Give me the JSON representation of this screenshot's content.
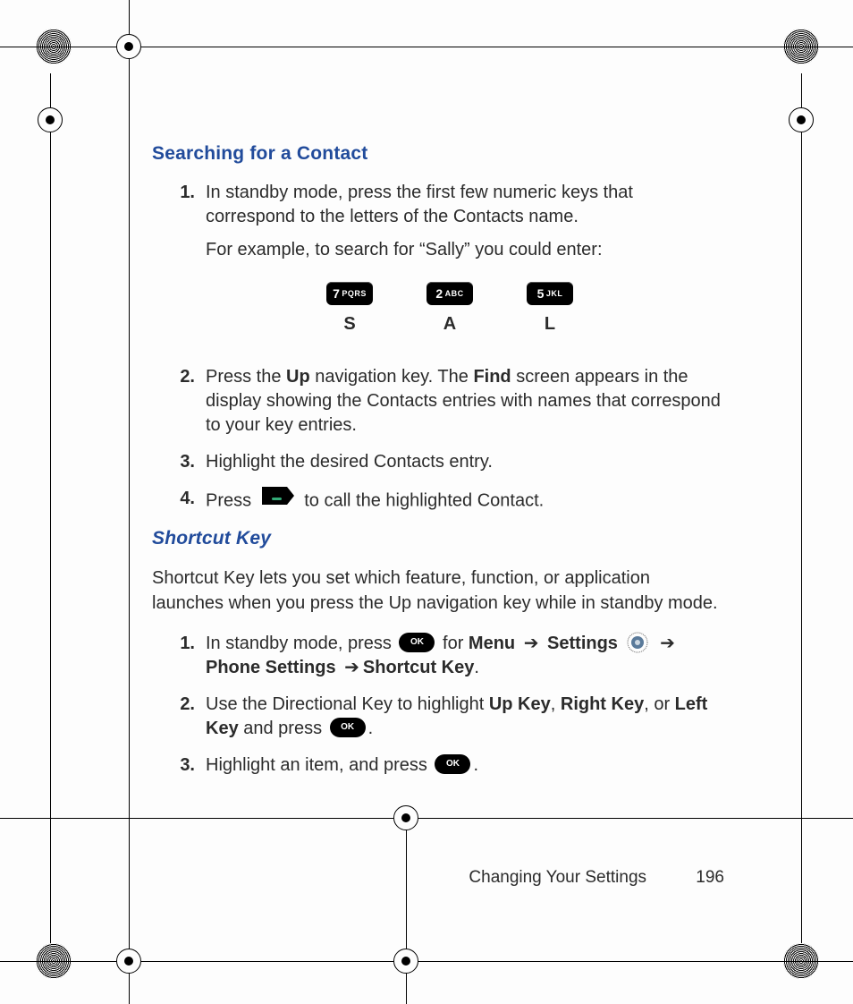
{
  "section1": {
    "heading": "Searching for a Contact",
    "steps": [
      {
        "num": "1.",
        "text_a": "In standby mode, press the first few numeric keys that correspond to the letters of the Contacts name.",
        "text_b": "For example, to search for “Sally” you could enter:"
      },
      {
        "num": "2.",
        "parts": [
          "Press the ",
          "Up",
          " navigation key. The ",
          "Find",
          " screen appears in the display showing the Contacts entries with names that correspond to your key entries."
        ]
      },
      {
        "num": "3.",
        "text": "Highlight the desired Contacts entry."
      },
      {
        "num": "4.",
        "pre": "Press ",
        "post": " to call the highlighted Contact."
      }
    ],
    "keys": [
      {
        "digit": "7",
        "letters": "PQRS",
        "below": "S"
      },
      {
        "digit": "2",
        "letters": "ABC",
        "below": "A"
      },
      {
        "digit": "5",
        "letters": "JKL",
        "below": "L"
      }
    ]
  },
  "section2": {
    "heading": "Shortcut Key",
    "intro": "Shortcut Key lets you set which feature, function, or application launches when you press the Up navigation key while in standby mode.",
    "steps": [
      {
        "num": "1.",
        "pre": "In standby mode, press ",
        "mid1": " for ",
        "b1": "Menu",
        "b2": "Settings",
        "b3": "Phone Settings",
        "b4": "Shortcut Key",
        "arrow": "➔",
        "period": "."
      },
      {
        "num": "2.",
        "pre": "Use the Directional Key to highlight ",
        "b1": "Up Key",
        "sep1": ", ",
        "b2": "Right Key",
        "sep2": ", or ",
        "b3": "Left Key",
        "mid": " and press ",
        "period": "."
      },
      {
        "num": "3.",
        "pre": "Highlight an item, and press ",
        "period": "."
      }
    ]
  },
  "footer": {
    "section": "Changing Your Settings",
    "page": "196"
  },
  "icons": {
    "ok_label": "OK"
  }
}
